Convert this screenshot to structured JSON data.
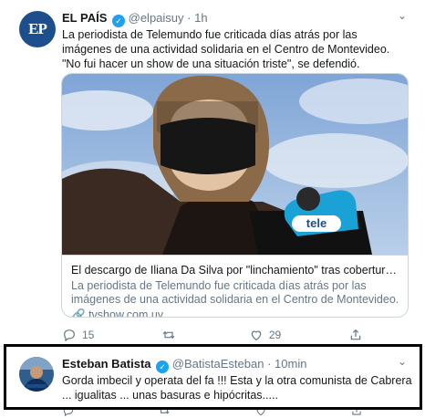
{
  "tweet1": {
    "avatar_text": "EP",
    "name": "EL PAÍS",
    "handle": "@elpaisuy",
    "separator": "·",
    "time": "1h",
    "text": "La periodista de Telemundo fue criticada días atrás por las imágenes de una actividad solidaria en el Centro de Montevideo. \"No fui hacer un show de una situación triste\", se defendió.",
    "card": {
      "mic_label": "tele",
      "title": "El descargo de Iliana Da Silva por \"linchamiento\" tras cobertura de un...",
      "description": "La periodista de Telemundo fue criticada días atrás por las imágenes de una actividad solidaria en el Centro de Montevideo. \"No fui hacer ...",
      "domain": "tvshow.com.uy"
    },
    "actions": {
      "reply_count": "15",
      "retweet_count": "",
      "like_count": "29"
    }
  },
  "tweet2": {
    "name": "Esteban Batista",
    "handle": "@BatistaEsteban",
    "separator": "·",
    "time": "10min",
    "text": "Gorda imbecil y operata del fa !!! Esta y la otra comunista de Cabrera ... igualitas ... unas basuras e hipócritas....."
  },
  "colors": {
    "accent": "#1da1f2",
    "muted": "#657786",
    "text": "#14171a",
    "highlight_border": "#000000"
  },
  "icons": [
    "verified-icon",
    "chevron-down-icon",
    "reply-icon",
    "retweet-icon",
    "like-icon",
    "share-icon",
    "link-icon"
  ]
}
